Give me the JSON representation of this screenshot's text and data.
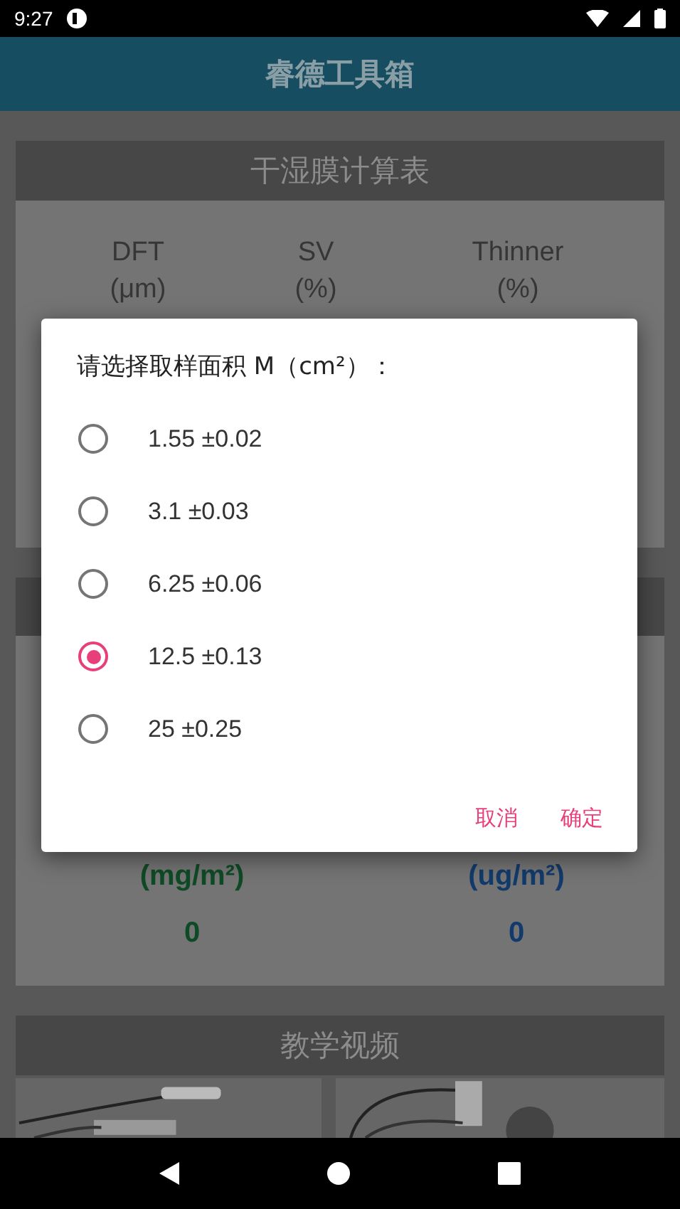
{
  "status_bar": {
    "time": "9:27"
  },
  "app_bar": {
    "title": "睿德工具箱"
  },
  "film_section": {
    "title": "干湿膜计算表",
    "columns": [
      {
        "label": "DFT",
        "unit": "(μm)"
      },
      {
        "label": "SV",
        "unit": "(%)"
      },
      {
        "label": "Thinner",
        "unit": "(%)"
      }
    ]
  },
  "result_section": {
    "columns": [
      {
        "unit": "(mg/m²)",
        "value": "0",
        "color": "#0f4a26"
      },
      {
        "unit": "(ug/m²)",
        "value": "0",
        "color": "#123a6a"
      }
    ]
  },
  "video_section": {
    "title": "教学视频"
  },
  "dialog": {
    "title": "请选择取样面积 M（cm²）：",
    "options": [
      {
        "label": "1.55 ±0.02",
        "selected": false
      },
      {
        "label": "3.1 ±0.03",
        "selected": false
      },
      {
        "label": "6.25 ±0.06",
        "selected": false
      },
      {
        "label": "12.5 ±0.13",
        "selected": true
      },
      {
        "label": "25 ±0.25",
        "selected": false
      }
    ],
    "buttons": [
      "取消",
      "确定"
    ]
  }
}
